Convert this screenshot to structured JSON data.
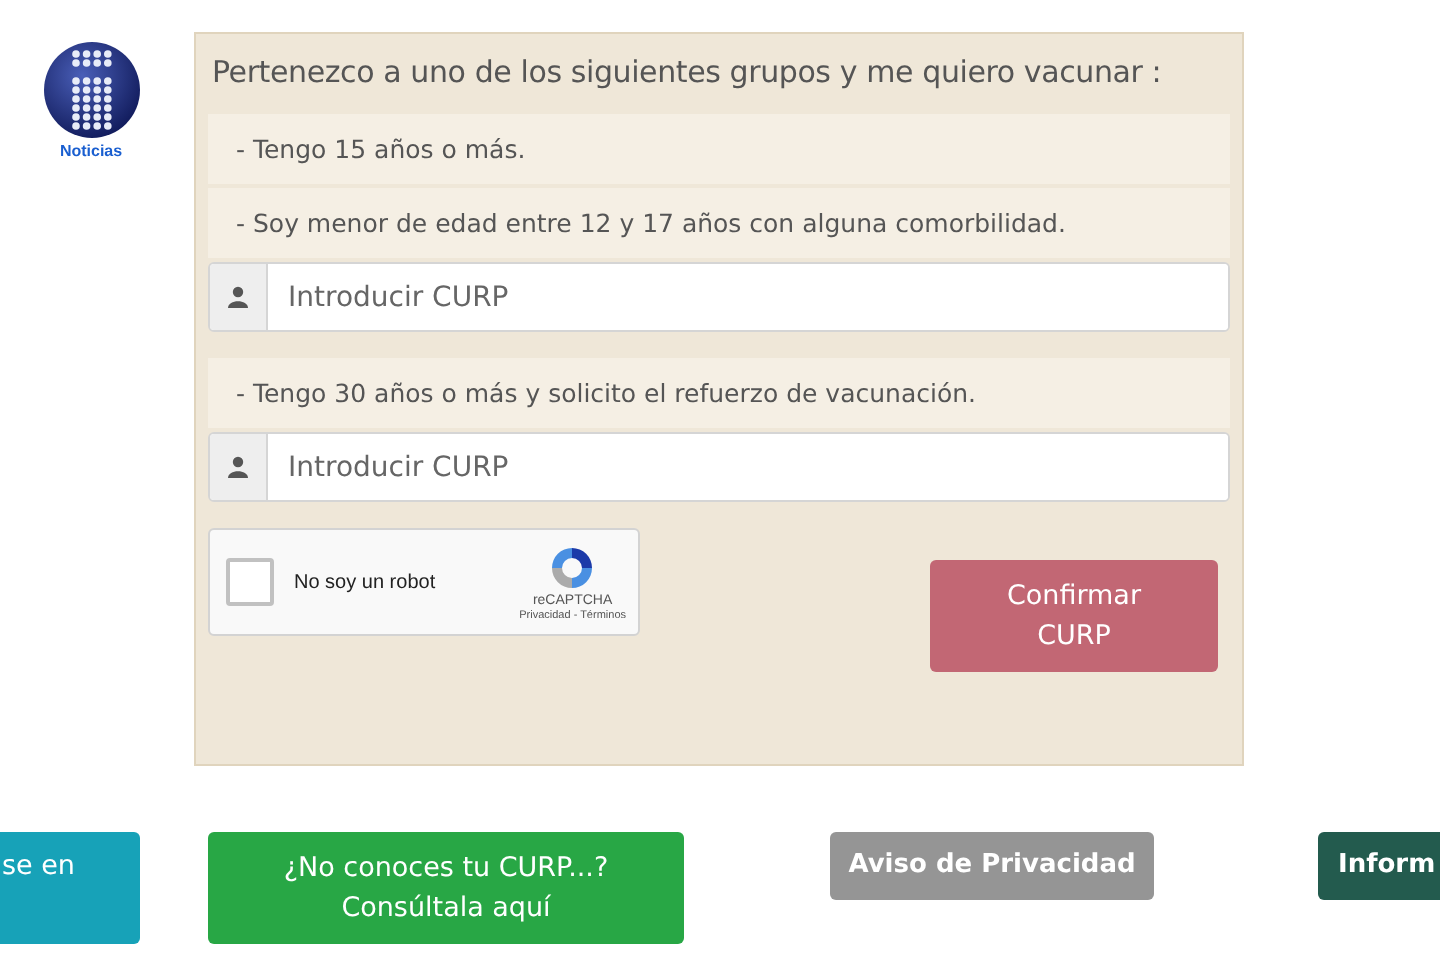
{
  "logo": {
    "caption": "Noticias"
  },
  "panel": {
    "title": "Pertenezco a uno de los siguientes grupos y me quiero vacunar :",
    "groups": [
      {
        "kind": "option",
        "label": "- Tengo 15 años o más."
      },
      {
        "kind": "option",
        "label": "- Soy menor de edad entre 12 y 17 años con alguna comorbilidad."
      },
      {
        "kind": "input",
        "placeholder": "Introducir CURP"
      },
      {
        "kind": "option",
        "label": "- Tengo 30 años o más y solicito el refuerzo de vacunación."
      },
      {
        "kind": "input",
        "placeholder": "Introducir CURP"
      }
    ],
    "captcha": {
      "label": "No soy un robot",
      "checked": false,
      "brand": "reCAPTCHA",
      "links": "Privacidad - Términos"
    },
    "confirm_button": {
      "label": "Confirmar CURP",
      "disabled": true
    }
  },
  "footer_buttons": [
    {
      "label": "se en",
      "color": "#17a2b8"
    },
    {
      "label": "¿No conoces tu CURP...? Consúltala aquí",
      "color": "#28a745"
    },
    {
      "label": "Aviso de Privacidad",
      "color": "#959595"
    },
    {
      "label": "Inform",
      "color": "#235b4e"
    }
  ]
}
